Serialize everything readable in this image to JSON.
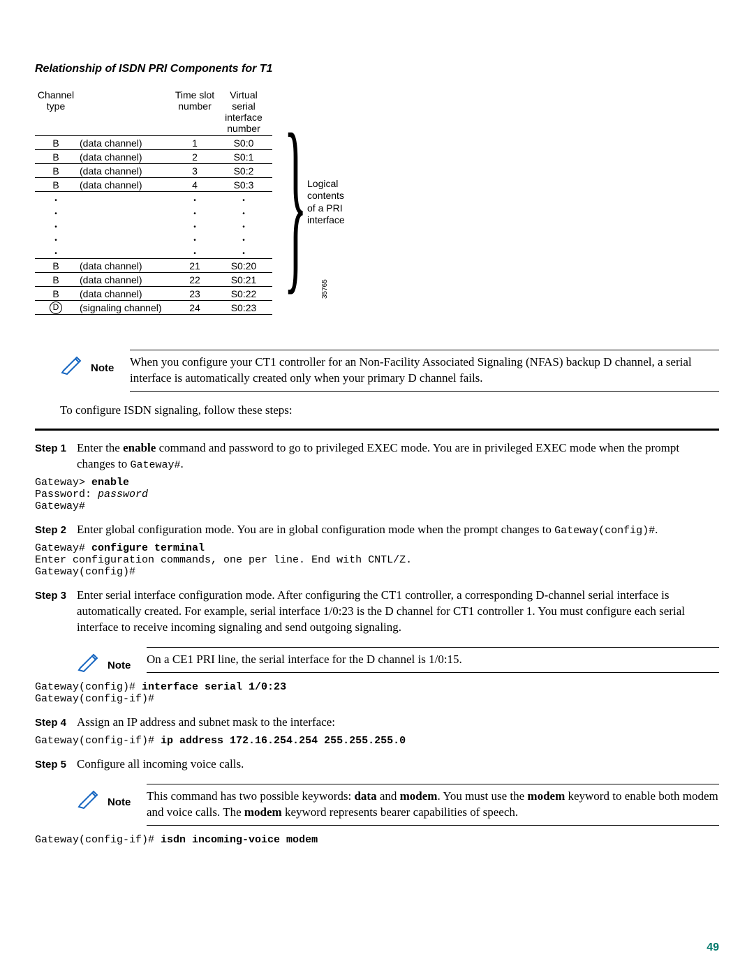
{
  "title": "Relationship of ISDN PRI Components for T1",
  "table": {
    "headers": {
      "col1": "Channel\ntype",
      "col3": "Time slot\nnumber",
      "col4": "Virtual\nserial\ninterface\nnumber"
    },
    "top_rows": [
      {
        "ct": "B",
        "desc": "(data channel)",
        "ts": "1",
        "vs": "S0:0"
      },
      {
        "ct": "B",
        "desc": "(data channel)",
        "ts": "2",
        "vs": "S0:1"
      },
      {
        "ct": "B",
        "desc": "(data channel)",
        "ts": "3",
        "vs": "S0:2"
      },
      {
        "ct": "B",
        "desc": "(data channel)",
        "ts": "4",
        "vs": "S0:3"
      }
    ],
    "bottom_rows": [
      {
        "ct": "B",
        "desc": "(data channel)",
        "ts": "21",
        "vs": "S0:20"
      },
      {
        "ct": "B",
        "desc": "(data channel)",
        "ts": "22",
        "vs": "S0:21"
      },
      {
        "ct": "B",
        "desc": "(data channel)",
        "ts": "23",
        "vs": "S0:22"
      },
      {
        "ct": "D",
        "desc": "(signaling channel)",
        "ts": "24",
        "vs": "S0:23",
        "circled": true
      }
    ],
    "brace_label": "Logical\ncontents\nof a PRI\ninterface",
    "fig_num": "35765"
  },
  "note1": "When you configure your CT1 controller for an Non-Facility Associated Signaling (NFAS) backup D channel, a serial interface is automatically created only when your primary D channel fails.",
  "intro": "To configure ISDN signaling, follow these steps:",
  "steps": {
    "s1": {
      "label": "Step 1",
      "body_pre": "Enter the ",
      "body_b1": "enable",
      "body_mid": " command and password to go to privileged EXEC mode. You are in privileged EXEC mode when the prompt changes to ",
      "body_mono": "Gateway#",
      "body_post": "."
    },
    "c1_l1": "Gateway> ",
    "c1_b": "enable",
    "c1_l2": "Password: ",
    "c1_i": "password",
    "c1_l3": "Gateway#",
    "s2": {
      "label": "Step 2",
      "body_pre": "Enter global configuration mode. You are in global configuration mode when the prompt changes to ",
      "body_mono": "Gateway(config)#",
      "body_post": "."
    },
    "c2_l1": "Gateway# ",
    "c2_b": "configure terminal",
    "c2_l2": "Enter configuration commands, one per line. End with CNTL/Z.",
    "c2_l3": "Gateway(config)#",
    "s3": {
      "label": "Step 3",
      "body": "Enter serial interface configuration mode. After configuring the CT1 controller, a corresponding D-channel serial interface is automatically created. For example, serial interface 1/0:23 is the D channel for CT1 controller 1. You must configure each serial interface to receive incoming signaling and send outgoing signaling."
    },
    "note3": "On a CE1 PRI line, the serial interface for the D channel is 1/0:15.",
    "c3_l1": "Gateway(config)# ",
    "c3_b": "interface serial 1/0:23",
    "c3_l2": "Gateway(config-if)#",
    "s4": {
      "label": "Step 4",
      "body": "Assign an IP address and subnet mask to the interface:"
    },
    "c4_l1": "Gateway(config-if)# ",
    "c4_b": "ip address 172.16.254.254 255.255.255.0",
    "s5": {
      "label": "Step 5",
      "body": "Configure all incoming voice calls."
    },
    "note5_pre": "This command has two possible keywords: ",
    "note5_b1": "data",
    "note5_mid1": " and ",
    "note5_b2": "modem",
    "note5_mid2": ". You must use the ",
    "note5_b3": "modem",
    "note5_mid3": " keyword to enable both modem and voice calls. The ",
    "note5_b4": "modem",
    "note5_post": " keyword represents bearer capabilities of speech.",
    "c5_l1": "Gateway(config-if)# ",
    "c5_b": "isdn incoming-voice modem"
  },
  "note_label": "Note",
  "page_number": "49"
}
